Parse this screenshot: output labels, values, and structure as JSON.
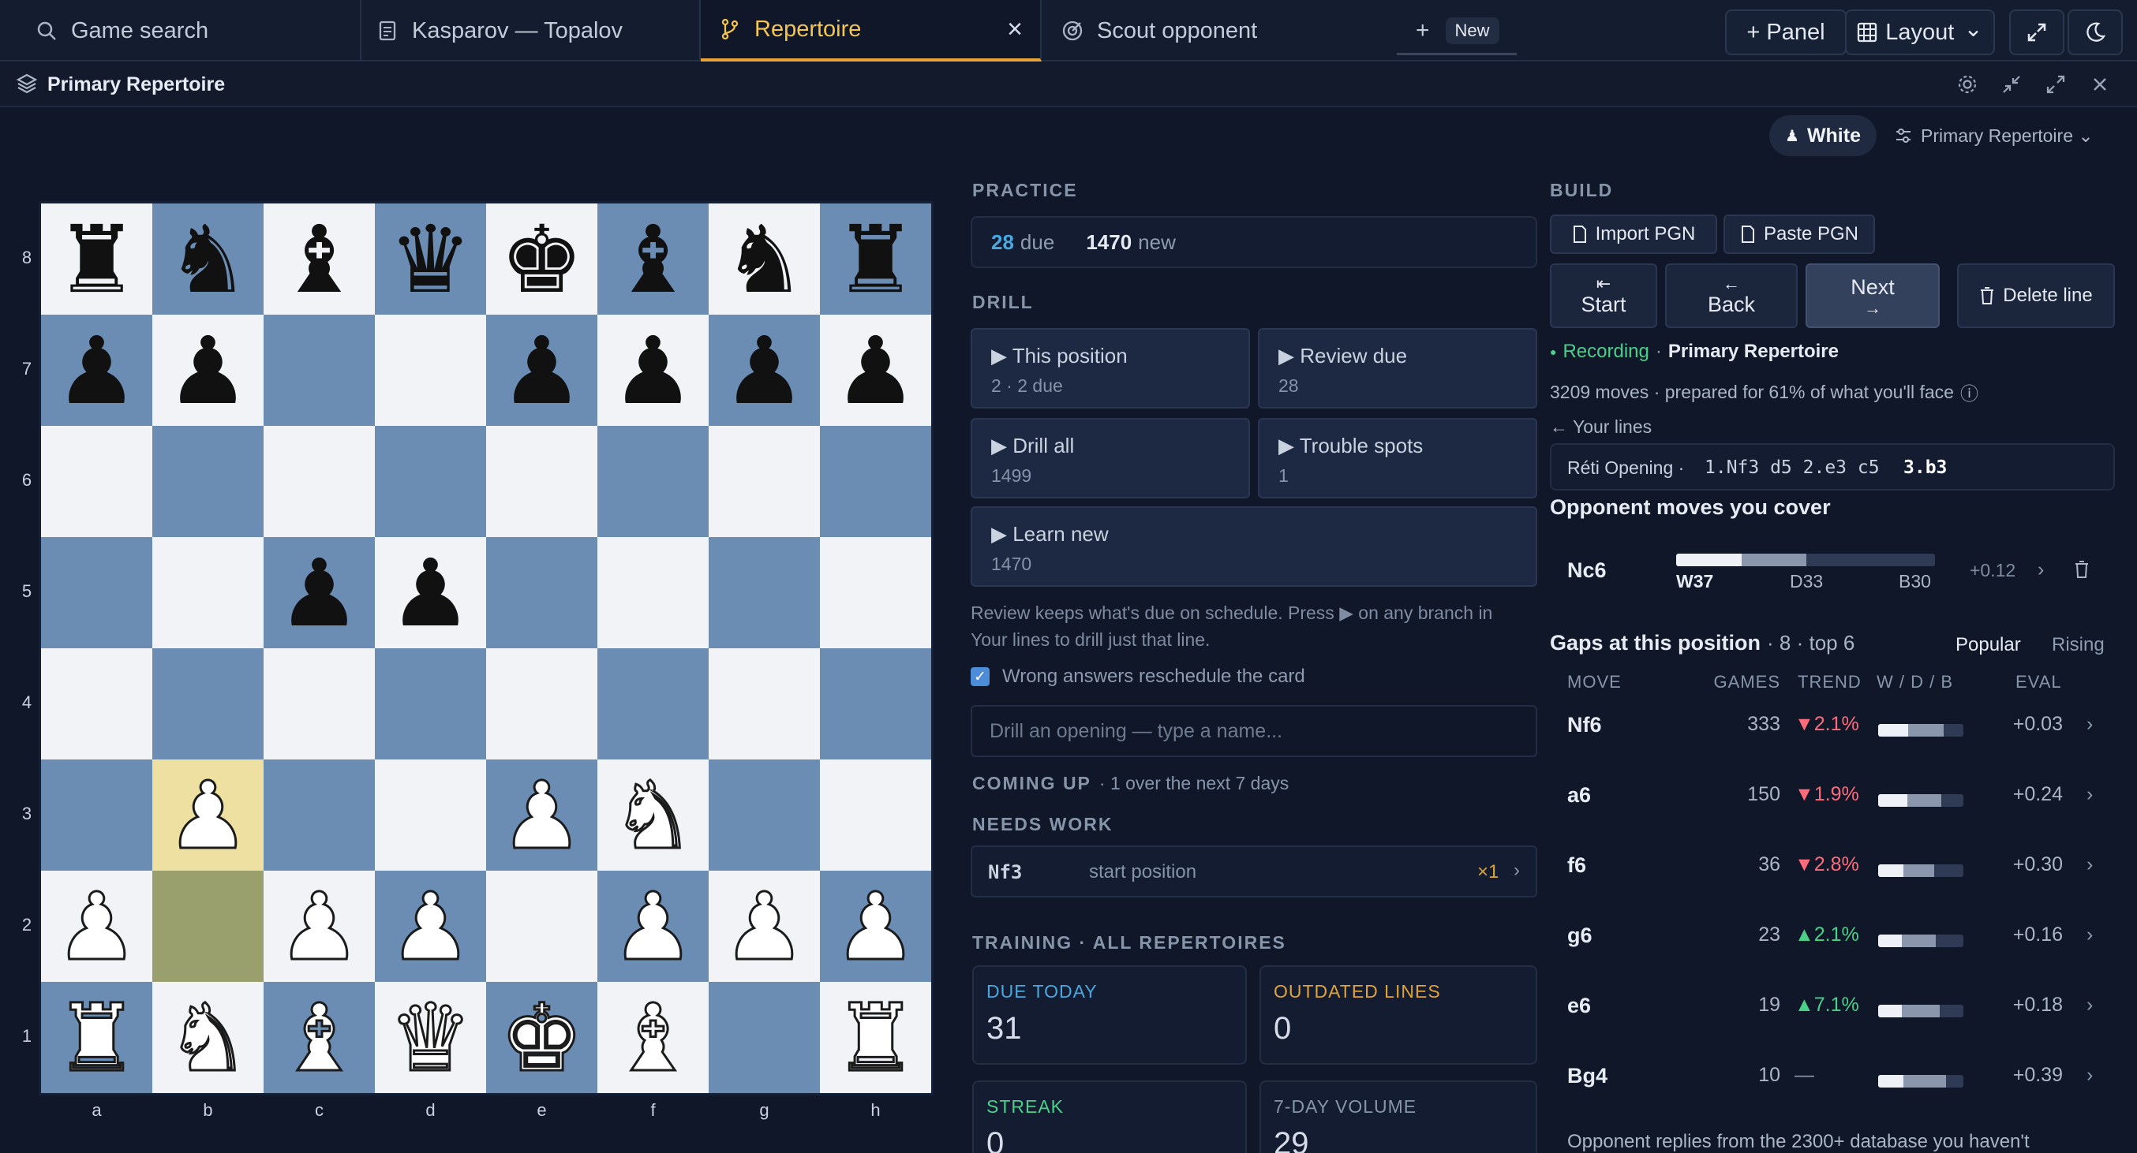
{
  "tabs": [
    {
      "label": "Game search",
      "icon": "search-icon"
    },
    {
      "label": "Kasparov — Topalov",
      "icon": "document-icon"
    },
    {
      "label": "Repertoire",
      "icon": "branch-icon",
      "active": true
    },
    {
      "label": "Scout opponent",
      "icon": "target-icon"
    }
  ],
  "tabbar": {
    "close": "×",
    "new_label": "+",
    "new_badge": "New"
  },
  "toolbar": {
    "panel_label": "+ Panel",
    "layout_label": "Layout",
    "layout_chevron": "⌄"
  },
  "panel": {
    "title": "Primary Repertoire"
  },
  "side": {
    "color_label": "White",
    "repertoire_label": "Primary Repertoire ⌄"
  },
  "board": {
    "files": [
      "a",
      "b",
      "c",
      "d",
      "e",
      "f",
      "g",
      "h"
    ],
    "ranks": [
      "8",
      "7",
      "6",
      "5",
      "4",
      "3",
      "2",
      "1"
    ],
    "rows": [
      [
        "r",
        "n",
        "b",
        "q",
        "k",
        "b",
        "n",
        "r"
      ],
      [
        "p",
        "p",
        "",
        "",
        "p",
        "p",
        "p",
        "p"
      ],
      [
        "",
        "",
        "",
        "",
        "",
        "",
        "",
        ""
      ],
      [
        "",
        "",
        "p",
        "p",
        "",
        "",
        "",
        ""
      ],
      [
        "",
        "",
        "",
        "",
        "",
        "",
        "",
        ""
      ],
      [
        "",
        "P",
        "",
        "",
        "P",
        "N",
        "",
        ""
      ],
      [
        "P",
        "",
        "P",
        "P",
        "",
        "P",
        "P",
        "P"
      ],
      [
        "R",
        "N",
        "B",
        "Q",
        "K",
        "B",
        "",
        "R"
      ]
    ],
    "last_move": {
      "from": "b2",
      "to": "b3"
    }
  },
  "practice": {
    "label": "PRACTICE",
    "due_count": "28",
    "due_text": "due",
    "new_count": "1470",
    "new_text": "new"
  },
  "drill": {
    "label": "DRILL",
    "cards": [
      {
        "title": "▶ This position",
        "sub": "2 · 2 due"
      },
      {
        "title": "▶ Review due",
        "sub": "28"
      },
      {
        "title": "▶ Drill all",
        "sub": "1499"
      },
      {
        "title": "▶ Trouble spots",
        "sub": "1"
      },
      {
        "title": "▶ Learn new",
        "sub": "1470"
      }
    ],
    "help": "Review keeps what's due on schedule. Press ▶ on any branch in Your lines to drill just that line.",
    "checkbox_label": "Wrong answers reschedule the card",
    "input_placeholder": "Drill an opening — type a name..."
  },
  "coming_up": {
    "label": "COMING UP",
    "text": "· 1 over the next 7 days"
  },
  "needs_work": {
    "label": "NEEDS WORK",
    "move": "Nf3",
    "context": "start position",
    "count": "×1",
    "chevron": "›"
  },
  "training": {
    "label": "TRAINING · ALL REPERTOIRES",
    "cards": [
      {
        "label": "DUE TODAY",
        "value": "31",
        "color": "#4aa8e0"
      },
      {
        "label": "OUTDATED LINES",
        "value": "0",
        "color": "#e0a33a"
      },
      {
        "label": "STREAK",
        "value": "0",
        "color": "#4bd08a"
      },
      {
        "label": "7-DAY VOLUME",
        "value": "29",
        "color": "#8795aa"
      }
    ]
  },
  "build": {
    "label": "BUILD",
    "import_label": "Import PGN",
    "paste_label": "Paste PGN",
    "start_icon": "⇤",
    "start_label": "Start",
    "back_icon": "←",
    "back_label": "Back",
    "next_label": "Next",
    "next_icon": "→",
    "delete_label": "Delete line"
  },
  "recording": {
    "dot": "●",
    "label": "Recording",
    "sep": "·",
    "name": "Primary Repertoire",
    "summary": "3209 moves · prepared for 61% of what you'll face",
    "info_icon": "ⓘ"
  },
  "your_lines": {
    "label": "← Your lines",
    "opening": "Réti Opening ·",
    "moves": "1.Nf3 d5 2.e3 c5",
    "current": "3.b3"
  },
  "coverage": {
    "title": "Opponent moves you cover",
    "move": "Nc6",
    "white_label": "W37",
    "draw_label": "D33",
    "black_label": "B30",
    "white": 37,
    "draw": 33,
    "black": 30,
    "eval": "+0.12",
    "chevron": "›"
  },
  "gaps": {
    "title": "Gaps at this position",
    "meta": "· 8 · top 6",
    "tab_popular": "Popular",
    "tab_rising": "Rising",
    "headers": {
      "move": "MOVE",
      "games": "GAMES",
      "trend": "TREND",
      "wdb": "W / D / B",
      "eval": "EVAL"
    },
    "rows": [
      {
        "move": "Nf6",
        "games": "333",
        "trend": "▼2.1%",
        "dir": "down",
        "w": 35,
        "d": 42,
        "b": 23,
        "eval": "+0.03"
      },
      {
        "move": "a6",
        "games": "150",
        "trend": "▼1.9%",
        "dir": "down",
        "w": 34,
        "d": 40,
        "b": 26,
        "eval": "+0.24"
      },
      {
        "move": "f6",
        "games": "36",
        "trend": "▼2.8%",
        "dir": "down",
        "w": 30,
        "d": 36,
        "b": 34,
        "eval": "+0.30"
      },
      {
        "move": "g6",
        "games": "23",
        "trend": "▲2.1%",
        "dir": "up",
        "w": 28,
        "d": 40,
        "b": 32,
        "eval": "+0.16"
      },
      {
        "move": "e6",
        "games": "19",
        "trend": "▲7.1%",
        "dir": "up",
        "w": 28,
        "d": 44,
        "b": 28,
        "eval": "+0.18"
      },
      {
        "move": "Bg4",
        "games": "10",
        "trend": "—",
        "dir": "neutral",
        "w": 30,
        "d": 50,
        "b": 20,
        "eval": "+0.39"
      }
    ],
    "chevron": "›",
    "footer": "Opponent replies from the 2300+ database you haven't"
  }
}
